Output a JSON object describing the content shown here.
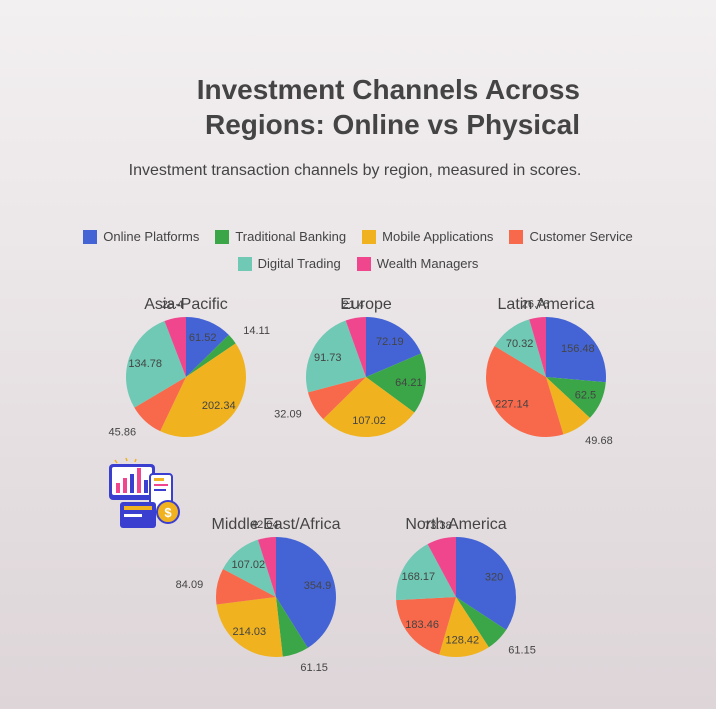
{
  "header": {
    "title_line1": "Investment Channels Across",
    "title_line2": "Regions: Online vs Physical",
    "subtitle": "Investment transaction channels by region, measured in scores."
  },
  "legend": [
    {
      "label": "Online Platforms",
      "color": "#4464d6"
    },
    {
      "label": "Traditional Banking",
      "color": "#3aa648"
    },
    {
      "label": "Mobile Applications",
      "color": "#f0b21e"
    },
    {
      "label": "Customer Service",
      "color": "#f8694b"
    },
    {
      "label": "Digital Trading",
      "color": "#6fc9b4"
    },
    {
      "label": "Wealth Managers",
      "color": "#f0468e"
    }
  ],
  "logo": {
    "icon": "investment-finance-logo-icon"
  },
  "chart_data": {
    "type": "pie",
    "categories": [
      "Online Platforms",
      "Traditional Banking",
      "Mobile Applications",
      "Customer Service",
      "Digital Trading",
      "Wealth Managers"
    ],
    "charts": [
      {
        "title": "Asia-Pacific",
        "values": [
          61.52,
          14.11,
          202.34,
          45.86,
          134.78,
          28.4
        ]
      },
      {
        "title": "Europe",
        "values": [
          72.19,
          64.21,
          107.02,
          32.09,
          91.73,
          21.4
        ]
      },
      {
        "title": "Latin America",
        "values": [
          156.48,
          62.5,
          49.68,
          227.14,
          70.32,
          26.76
        ]
      },
      {
        "title": "Middle East/Africa",
        "values": [
          354.9,
          61.15,
          214.03,
          84.09,
          107.02,
          42.04
        ]
      },
      {
        "title": "North America",
        "values": [
          320,
          61.15,
          128.42,
          183.46,
          168.17,
          73.38
        ]
      }
    ],
    "legend_position": "top-center"
  }
}
